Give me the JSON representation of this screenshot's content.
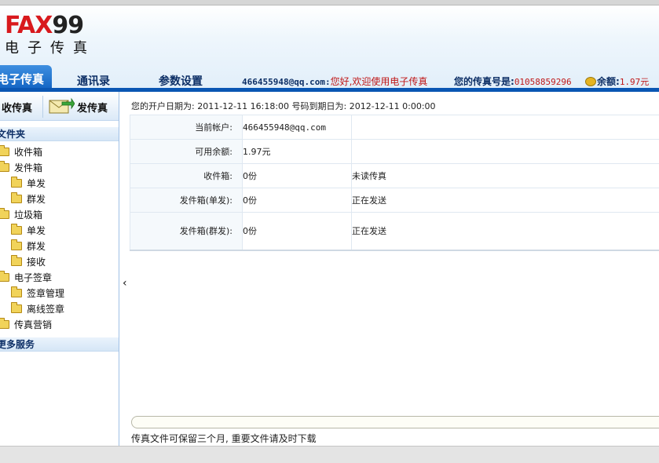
{
  "logo": {
    "brand_red": "FAX",
    "brand_dark": "99",
    "subtitle": "电子传真"
  },
  "nav": {
    "tabs": [
      {
        "label": "电子传真"
      },
      {
        "label": "通讯录"
      },
      {
        "label": "参数设置"
      }
    ],
    "account": "466455948@qq.com:",
    "greeting": "您好,欢迎使用电子传真",
    "fax_number_label": "您的传真号是:",
    "fax_number": "01058859296",
    "balance_label": "余额:",
    "balance": "1.97元"
  },
  "sidebar": {
    "receive_label": "收传真",
    "send_label": "发传真",
    "folders_title": "文件夹",
    "items": [
      {
        "label": "收件箱"
      },
      {
        "label": "发件箱"
      },
      {
        "label": "单发"
      },
      {
        "label": "群发"
      },
      {
        "label": "垃圾箱"
      },
      {
        "label": "单发"
      },
      {
        "label": "群发"
      },
      {
        "label": "接收"
      },
      {
        "label": "电子签章"
      },
      {
        "label": "签章管理"
      },
      {
        "label": "离线签章"
      },
      {
        "label": "传真营销"
      }
    ],
    "more_services": "更多服务"
  },
  "main": {
    "date_line": "您的开户日期为: 2011-12-11 16:18:00  号码到期日为: 2012-12-11 0:00:00",
    "rows": [
      {
        "label": "当前帐户:",
        "value": "466455948@qq.com",
        "status": ""
      },
      {
        "label": "可用余额:",
        "value": "1.97元",
        "status": ""
      },
      {
        "label": "收件箱:",
        "value": "0份",
        "status": "未读传真"
      },
      {
        "label": "发件箱(单发):",
        "value": "0份",
        "status": "正在发送"
      },
      {
        "label": "发件箱(群发):",
        "value": "0份",
        "status": "正在发送"
      }
    ],
    "footer_note": "传真文件可保留三个月, 重要文件请及时下载"
  },
  "colors": {
    "brand_red": "#d8191d",
    "nav_blue": "#0a56b3",
    "accent_red": "#c01818"
  }
}
